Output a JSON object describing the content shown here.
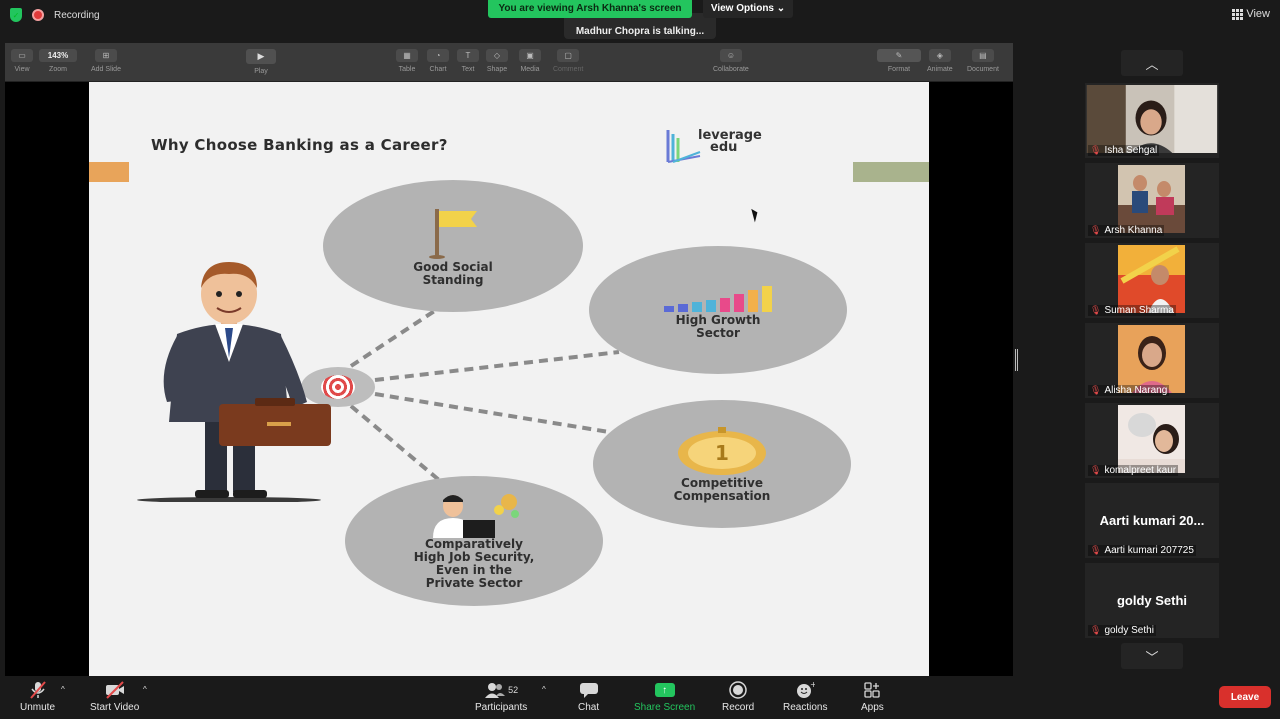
{
  "top": {
    "recording_label": "Recording",
    "viewing_banner": "You are viewing Arsh Khanna's screen",
    "view_options": "View Options",
    "talking_status": "Madhur Chopra is talking...",
    "view_label": "View"
  },
  "keynote_toolbar": {
    "view": "View",
    "zoom_value": "143%",
    "zoom": "Zoom",
    "add_slide": "Add Slide",
    "play": "Play",
    "table": "Table",
    "chart": "Chart",
    "text": "Text",
    "shape": "Shape",
    "media": "Media",
    "comment": "Comment",
    "collaborate": "Collaborate",
    "format": "Format",
    "animate": "Animate",
    "document": "Document"
  },
  "slide": {
    "title": "Why Choose Banking as a Career?",
    "logo_line1": "leverage",
    "logo_line2": "edu",
    "bubbles": [
      {
        "line1": "Good Social",
        "line2": "Standing",
        "line3": "",
        "line4": ""
      },
      {
        "line1": "High Growth",
        "line2": "Sector",
        "line3": "",
        "line4": ""
      },
      {
        "line1": "Competitive",
        "line2": "Compensation",
        "line3": "",
        "line4": ""
      },
      {
        "line1": "Comparatively",
        "line2": "High Job Security,",
        "line3": "Even in the",
        "line4": "Private Sector"
      }
    ],
    "coin_number": "1"
  },
  "participants": [
    {
      "name": "Isha Sehgal"
    },
    {
      "name": "Arsh Khanna"
    },
    {
      "name": "Suman Sharma"
    },
    {
      "name": "Alisha Narang"
    },
    {
      "name": "komalpreet kaur"
    },
    {
      "name": "Aarti kumari 207725",
      "display_name": "Aarti kumari 20..."
    },
    {
      "name": "goldy Sethi",
      "display_name": "goldy Sethi"
    }
  ],
  "controls": {
    "unmute": "Unmute",
    "start_video": "Start Video",
    "participants": "Participants",
    "participant_count": "52",
    "chat": "Chat",
    "share_screen": "Share Screen",
    "record": "Record",
    "reactions": "Reactions",
    "apps": "Apps",
    "leave": "Leave"
  },
  "colors": {
    "share_green": "#23c55e",
    "leave_red": "#d9302c",
    "mic_off_red": "#e24a4a"
  }
}
